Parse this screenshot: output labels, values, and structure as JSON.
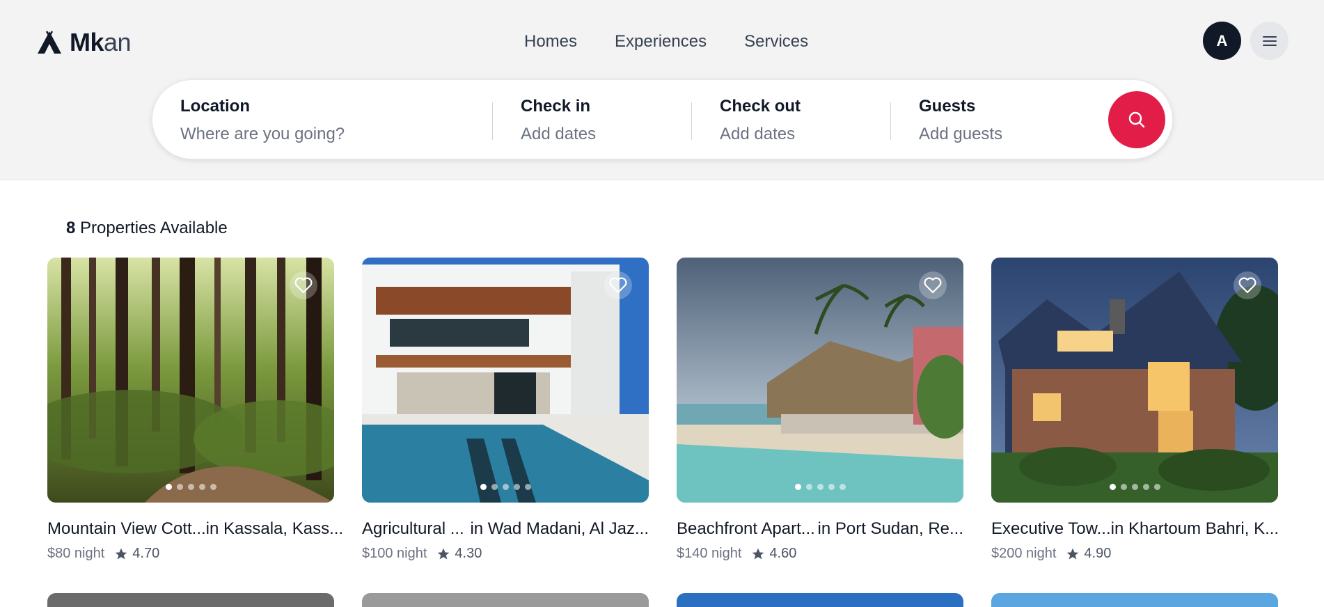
{
  "brand": {
    "bold": "Mk",
    "light": "an"
  },
  "nav": [
    "Homes",
    "Experiences",
    "Services"
  ],
  "user": {
    "initial": "A"
  },
  "search": {
    "location": {
      "label": "Location",
      "placeholder": "Where are you going?"
    },
    "checkin": {
      "label": "Check in",
      "placeholder": "Add dates"
    },
    "checkout": {
      "label": "Check out",
      "placeholder": "Add dates"
    },
    "guests": {
      "label": "Guests",
      "placeholder": "Add guests"
    }
  },
  "results": {
    "count": "8",
    "suffix": "Properties Available"
  },
  "listings": [
    {
      "title": "Mountain View Cott...",
      "location": "in Kassala, Kass...",
      "price": "$80 night",
      "rating": "4.70",
      "active_image": 1,
      "image_count": 5
    },
    {
      "title": "Agricultural ...",
      "location": "in Wad Madani, Al Jaz...",
      "price": "$100 night",
      "rating": "4.30",
      "active_image": 1,
      "image_count": 5
    },
    {
      "title": "Beachfront Apart...",
      "location": "in Port Sudan, Re...",
      "price": "$140 night",
      "rating": "4.60",
      "active_image": 1,
      "image_count": 5
    },
    {
      "title": "Executive Tow...",
      "location": "in Khartoum Bahri, K...",
      "price": "$200 night",
      "rating": "4.90",
      "active_image": 1,
      "image_count": 5
    }
  ],
  "colors": {
    "accent": "#e11d48",
    "header_bg": "#f3f3f3",
    "avatar_bg": "#111827"
  },
  "icons": {
    "logo": "tent-icon",
    "menu": "hamburger-icon",
    "search": "search-icon",
    "favorite": "heart-icon",
    "rating": "star-icon"
  }
}
